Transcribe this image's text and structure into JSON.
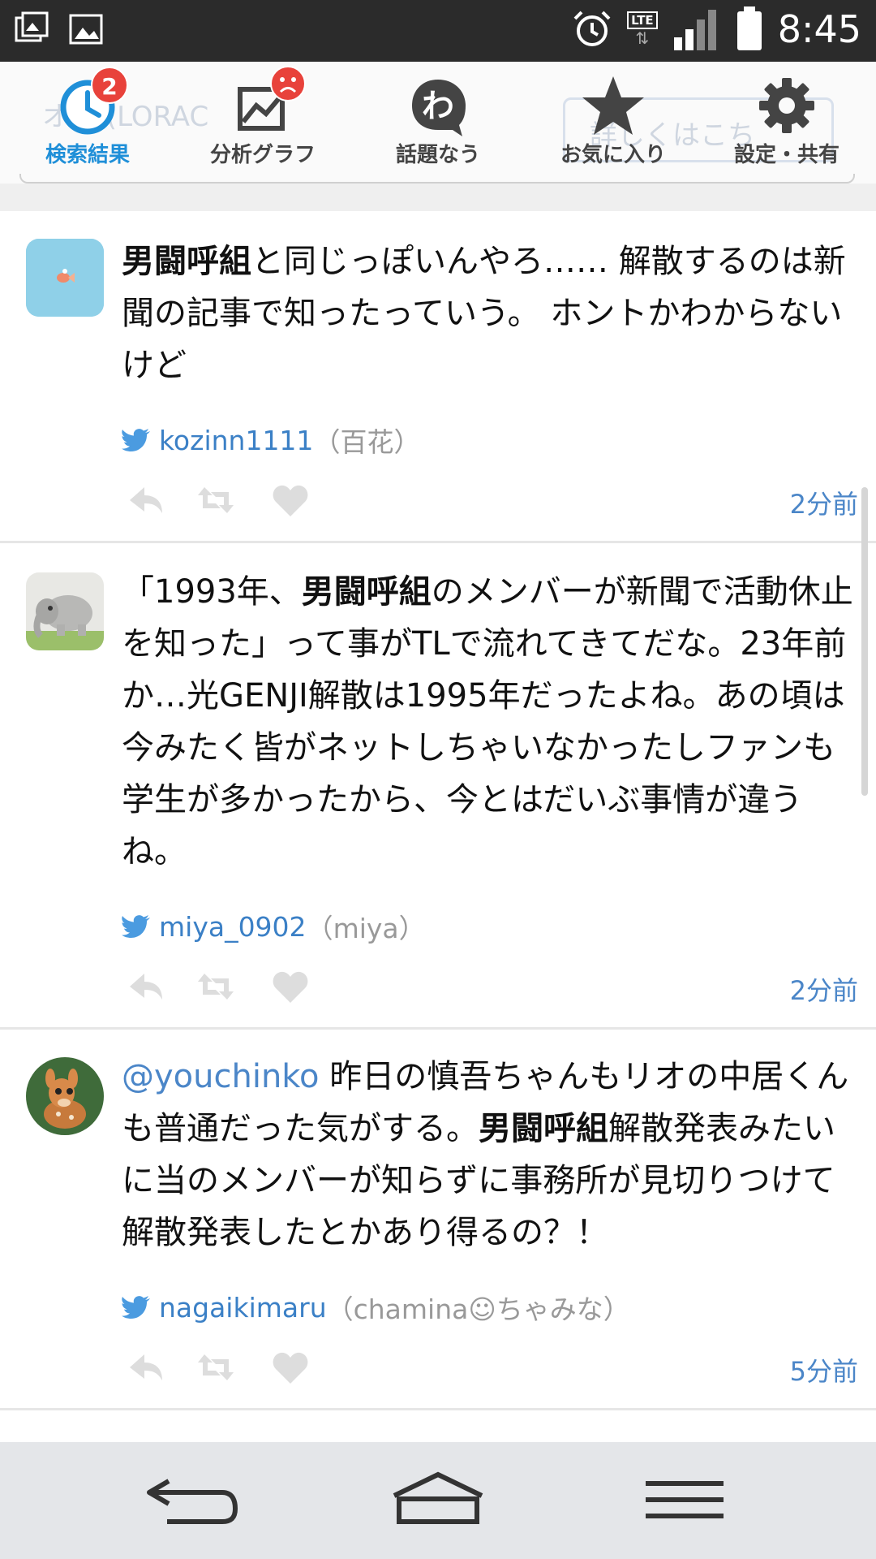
{
  "status_bar": {
    "time": "8:45",
    "network": "LTE"
  },
  "tabs": [
    {
      "label": "検索結果",
      "badge": "2",
      "icon": "clock-icon",
      "active": true
    },
    {
      "label": "分析グラフ",
      "badge": "☹",
      "icon": "chart-icon",
      "active": false
    },
    {
      "label": "話題なう",
      "icon": "wa-bubble-icon",
      "active": false
    },
    {
      "label": "お気に入り",
      "icon": "star-icon",
      "active": false
    },
    {
      "label": "設定・共有",
      "icon": "gear-icon",
      "active": false
    }
  ],
  "background_ghost": {
    "left_text": "オ   ル(LORAC",
    "right_text": "詳しくはこち"
  },
  "tweets": [
    {
      "highlight": "男闘呼組",
      "text_after": "と同じっぽいんやろ…… 解散するのは新聞の記事で知ったっていう。 ホントかわからないけど",
      "handle": "kozinn1111",
      "name": "（百花）",
      "time": "2分前",
      "avatar": "goldfish-avatar"
    },
    {
      "text_before": "「1993年、",
      "highlight": "男闘呼組",
      "text_after": "のメンバーが新聞で活動休止を知った」って事がTLで流れてきてだな。23年前か…光GENJI解散は1995年だったよね。あの頃は今みたく皆がネットしちゃいなかったしファンも学生が多かったから、今とはだいぶ事情が違うね。",
      "handle": "miya_0902",
      "name": "（miya）",
      "time": "2分前",
      "avatar": "elephant-avatar"
    },
    {
      "mention": "@youchinko",
      "text_before": " 昨日の慎吾ちゃんもリオの中居くんも普通だった気がする。",
      "highlight": "男闘呼組",
      "text_after": "解散発表みたいに当のメンバーが知らずに事務所が見切りつけて解散発表したとかあり得るの？！",
      "handle": "nagaikimaru",
      "name": "（chamina☺ちゃみな）",
      "time": "5分前",
      "avatar": "fawn-avatar"
    }
  ],
  "colors": {
    "accent": "#1f8fd8",
    "link": "#3b80c6",
    "badge": "#e8423b"
  }
}
